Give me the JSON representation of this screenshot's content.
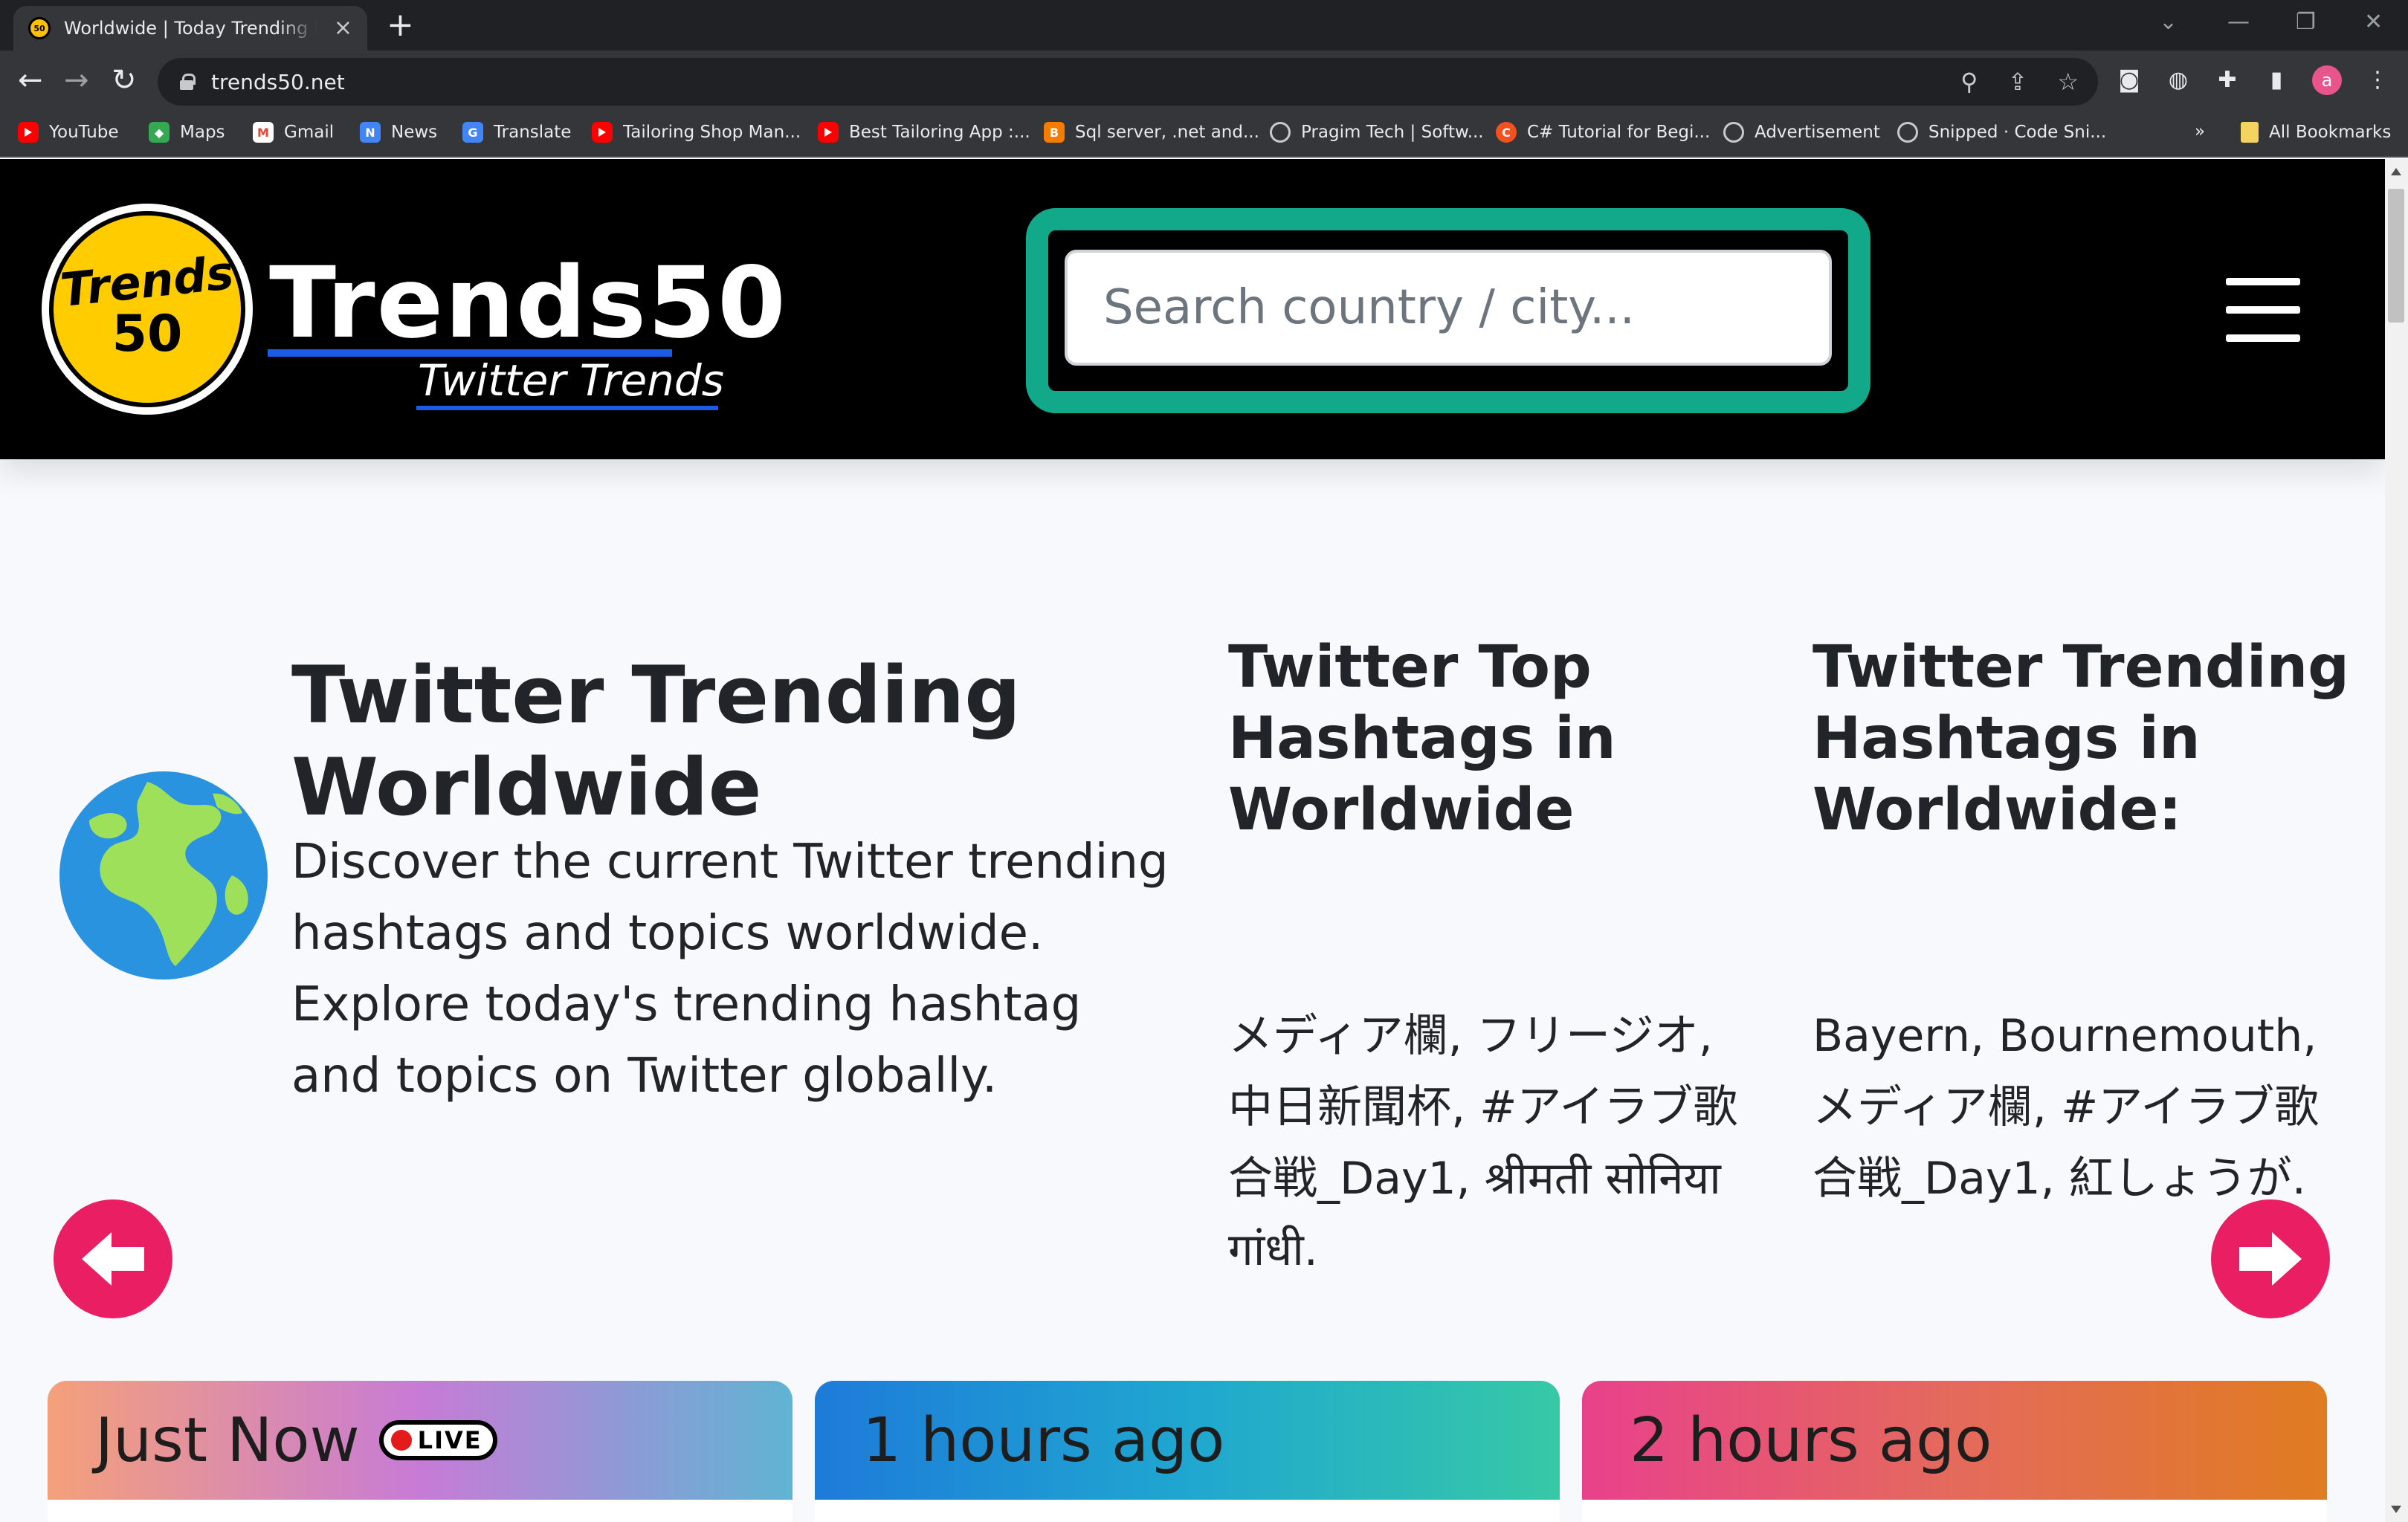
{
  "browser": {
    "tab_title": "Worldwide | Today Trending hashtags",
    "url": "trends50.net",
    "bookmarks": [
      {
        "label": "YouTube"
      },
      {
        "label": "Maps"
      },
      {
        "label": "Gmail"
      },
      {
        "label": "News"
      },
      {
        "label": "Translate"
      },
      {
        "label": "Tailoring Shop Man..."
      },
      {
        "label": "Best Tailoring App :..."
      },
      {
        "label": "Sql server, .net and..."
      },
      {
        "label": "Pragim Tech | Softw..."
      },
      {
        "label": "C# Tutorial for Begi..."
      },
      {
        "label": "Advertisement"
      },
      {
        "label": "Snipped · Code Sni..."
      }
    ],
    "bookmarks_overflow": "»",
    "all_bookmarks": "All Bookmarks",
    "profile_initial": "a"
  },
  "site": {
    "logo_line1": "Trends",
    "logo_line2": "50",
    "brand_name": "Trends50",
    "brand_subtitle": "Twitter Trends",
    "search_placeholder": "Search country / city..."
  },
  "hero": {
    "title": "Twitter Trending Worldwide",
    "description": "Discover the current Twitter trending hashtags and topics worldwide. Explore today's trending hashtag and topics on Twitter globally.",
    "col1_title": "Twitter Top Hashtags in Worldwide",
    "col1_body": "メディア欄, フリージオ, 中日新聞杯, #アイラブ歌合戦_Day1, श्रीमती सोनिया गांधी.",
    "col2_title": "Twitter Trending Hashtags in Worldwide:",
    "col2_body": "Bayern, Bournemouth, メディア欄, #アイラブ歌合戦_Day1, 紅しょうが."
  },
  "cards": [
    {
      "label": "Just Now",
      "badge": "LIVE",
      "gradient": [
        "#f4a07a",
        "#c77bd6",
        "#5fb4d4"
      ]
    },
    {
      "label": "1 hours ago",
      "gradient": [
        "#1e7bd9",
        "#1fa7d0",
        "#36c9a6"
      ]
    },
    {
      "label": "2 hours ago",
      "gradient": [
        "#e8418b",
        "#e46a5c",
        "#e07c20"
      ]
    }
  ],
  "colors": {
    "accent_teal": "#12a88a",
    "arrow_pink": "#e91e63",
    "logo_yellow": "#ffcc00",
    "brand_blue": "#1a5ce6"
  }
}
